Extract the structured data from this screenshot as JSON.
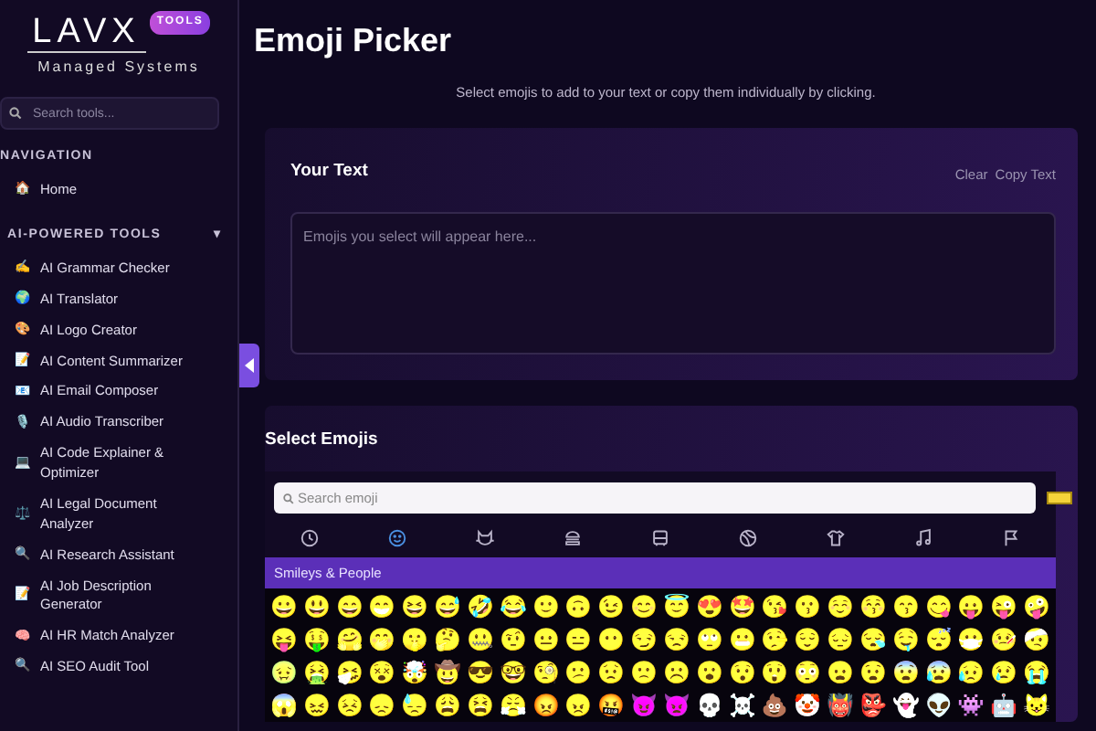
{
  "sidebar": {
    "logo": "LAVX",
    "logo_badge": "TOOLS",
    "logo_subtitle": "Managed Systems",
    "search": {
      "placeholder": "Search tools..."
    },
    "sections": [
      {
        "title": "NAVIGATION",
        "items": [
          {
            "icon": "🏠",
            "label": "Home"
          }
        ]
      },
      {
        "title": "AI-POWERED TOOLS",
        "caret": "▾",
        "items": [
          {
            "icon": "✍️",
            "label": "AI Grammar Checker"
          },
          {
            "icon": "🌍",
            "label": "AI Translator"
          },
          {
            "icon": "🎨",
            "label": "AI Logo Creator"
          },
          {
            "icon": "📝",
            "label": "AI Content Summarizer"
          },
          {
            "icon": "📧",
            "label": "AI Email Composer"
          },
          {
            "icon": "🎙️",
            "label": "AI Audio Transcriber"
          },
          {
            "icon": "💻",
            "label": "AI Code Explainer & Optimizer"
          },
          {
            "icon": "⚖️",
            "label": "AI Legal Document Analyzer"
          },
          {
            "icon": "🔍",
            "label": "AI Research Assistant"
          },
          {
            "icon": "📝",
            "label": "AI Job Description Generator"
          },
          {
            "icon": "🧠",
            "label": "AI HR Match Analyzer"
          },
          {
            "icon": "🔍",
            "label": "AI SEO Audit Tool"
          }
        ]
      }
    ]
  },
  "page": {
    "title": "Emoji Picker",
    "subtitle": "Select emojis to add to your text or copy them individually by clicking."
  },
  "your_text": {
    "title": "Your Text",
    "actions": [
      "Clear",
      "Copy Text"
    ],
    "placeholder": "Emojis you select will appear here..."
  },
  "select_emojis": {
    "title": "Select Emojis",
    "search": {
      "placeholder": "Search emoji"
    },
    "categories": [
      {
        "kind": "recent",
        "selected": false
      },
      {
        "kind": "smileys",
        "selected": true
      },
      {
        "kind": "animals",
        "selected": false
      },
      {
        "kind": "food",
        "selected": false
      },
      {
        "kind": "travel",
        "selected": false
      },
      {
        "kind": "activities",
        "selected": false
      },
      {
        "kind": "objects",
        "selected": false
      },
      {
        "kind": "symbols",
        "selected": false
      },
      {
        "kind": "flags",
        "selected": false
      }
    ],
    "group_title": "Smileys & People",
    "emojis": [
      "😀",
      "😃",
      "😄",
      "😁",
      "😆",
      "😅",
      "🤣",
      "😂",
      "🙂",
      "🙃",
      "😉",
      "😊",
      "😇",
      "😍",
      "🤩",
      "😘",
      "😗",
      "☺️",
      "😚",
      "😙",
      "😋",
      "😛",
      "😜",
      "🤪",
      "😝",
      "🤑",
      "🤗",
      "🤭",
      "🤫",
      "🤔",
      "🤐",
      "🤨",
      "😐",
      "😑",
      "😶",
      "😏",
      "😒",
      "🙄",
      "😬",
      "🤥",
      "😌",
      "😔",
      "😪",
      "🤤",
      "😴",
      "😷",
      "🤒",
      "🤕",
      "🤢",
      "🤮",
      "🤧",
      "😵",
      "🤯",
      "🤠",
      "😎",
      "🤓",
      "🧐",
      "😕",
      "😟",
      "🙁",
      "☹️",
      "😮",
      "😯",
      "😲",
      "😳",
      "😦",
      "😧",
      "😨",
      "😰",
      "😥",
      "😢",
      "😭",
      "😱",
      "😖",
      "😣",
      "😞",
      "😓",
      "😩",
      "😫",
      "😤",
      "😡",
      "😠",
      "🤬",
      "😈",
      "👿",
      "💀",
      "☠️",
      "💩",
      "🤡",
      "👹",
      "👺",
      "👻",
      "👽",
      "👾",
      "🤖",
      "😺"
    ]
  }
}
